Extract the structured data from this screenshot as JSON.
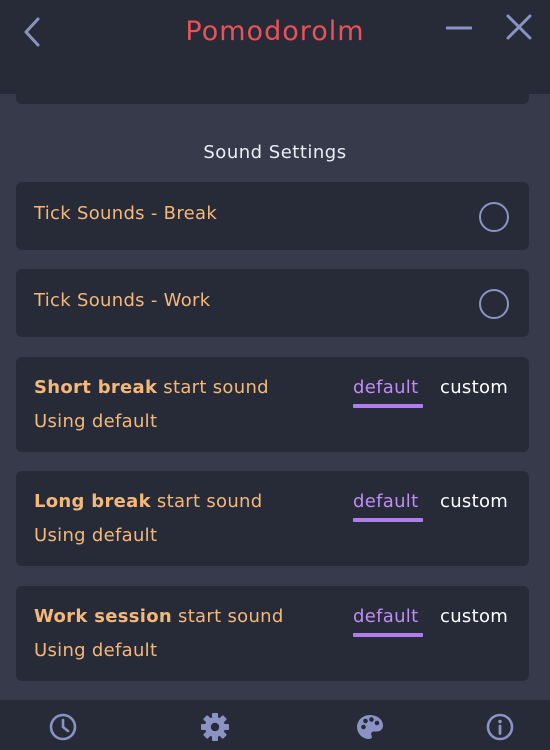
{
  "window": {
    "title": "Pomodorolm"
  },
  "section": {
    "title": "Sound Settings"
  },
  "toggles": [
    {
      "label": "Tick Sounds - Break",
      "checked": false
    },
    {
      "label": "Tick Sounds - Work",
      "checked": false
    }
  ],
  "sounds": [
    {
      "bold": "Short break",
      "rest": " start sound",
      "status": "Using default",
      "default_label": "default",
      "custom_label": "custom",
      "selected": "default"
    },
    {
      "bold": "Long break",
      "rest": " start sound",
      "status": "Using default",
      "default_label": "default",
      "custom_label": "custom",
      "selected": "default"
    },
    {
      "bold": "Work session",
      "rest": " start sound",
      "status": "Using default",
      "default_label": "default",
      "custom_label": "custom",
      "selected": "default"
    }
  ],
  "icons": {
    "back": "chevron-left-icon",
    "minimize": "minimize-icon",
    "close": "close-icon",
    "nav": [
      "clock-icon",
      "gear-icon",
      "palette-icon",
      "info-icon"
    ]
  },
  "colors": {
    "background": "#363A4A",
    "card": "#272B38",
    "title_red": "#E8525B",
    "label_orange": "#F4B97A",
    "accent_purple": "#C08CF5",
    "icon_blue": "#8A93C4"
  }
}
